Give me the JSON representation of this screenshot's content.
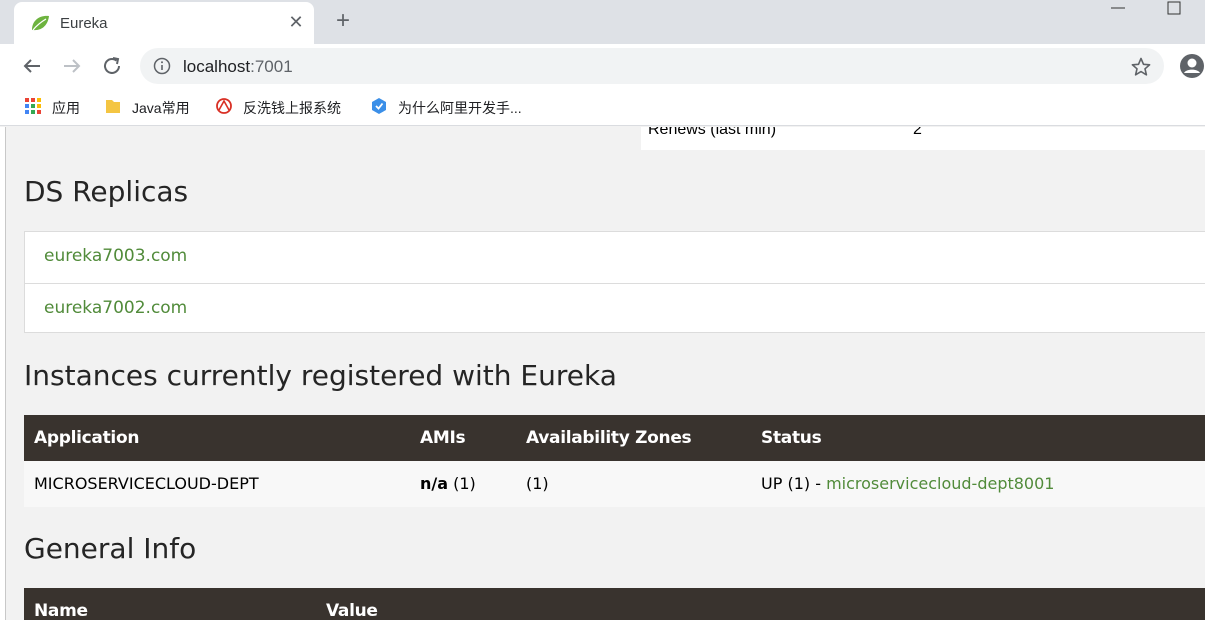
{
  "browser": {
    "tab_title": "Eureka",
    "url_host": "localhost",
    "url_port": ":7001",
    "bookmarks": [
      {
        "label": "应用",
        "icon": "apps-grid-icon"
      },
      {
        "label": "Java常用",
        "icon": "folder-icon"
      },
      {
        "label": "反洗钱上报系统",
        "icon": "site-icon"
      },
      {
        "label": "为什么阿里开发手...",
        "icon": "site-icon"
      }
    ]
  },
  "page": {
    "renews_label": "Renews (last min)",
    "renews_value": "2",
    "replicas_heading": "DS Replicas",
    "replicas": [
      "eureka7003.com",
      "eureka7002.com"
    ],
    "instances_heading": "Instances currently registered with Eureka",
    "instances_columns": [
      "Application",
      "AMIs",
      "Availability Zones",
      "Status"
    ],
    "instances": [
      {
        "application": "MICROSERVICECLOUD-DEPT",
        "amis_bold": "n/a",
        "amis_count": " (1)",
        "zones": "(1)",
        "status_prefix": "UP (1) - ",
        "status_link": "microservicecloud-dept8001"
      }
    ],
    "general_heading": "General Info",
    "general_columns": [
      "Name",
      "Value"
    ]
  },
  "colors": {
    "accent_green": "#518b3a",
    "table_header": "#39332e"
  }
}
